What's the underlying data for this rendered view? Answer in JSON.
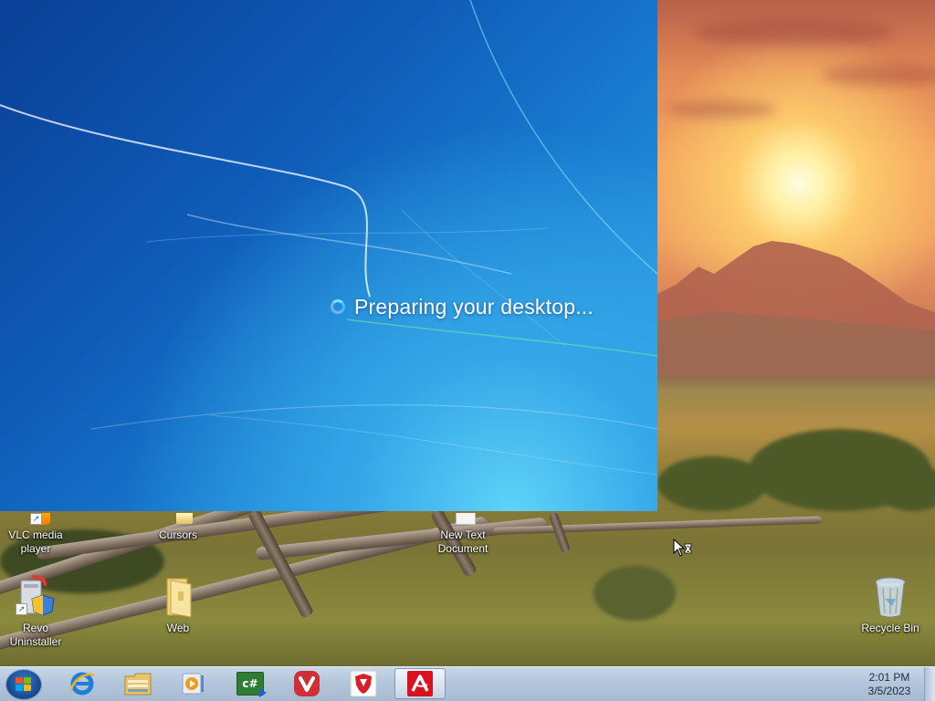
{
  "welcome": {
    "message": "Preparing your desktop..."
  },
  "desktop_icons": [
    {
      "label": "VLC media player",
      "icon": "vlc-icon",
      "shortcut": true
    },
    {
      "label": "Cursors",
      "icon": "folder-icon",
      "shortcut": false
    },
    {
      "label": "New Text Document",
      "icon": "text-document-icon",
      "shortcut": false
    },
    {
      "label": "Revo Uninstaller",
      "icon": "revo-uninstaller-icon",
      "shortcut": true
    },
    {
      "label": "Web",
      "icon": "folder-icon",
      "shortcut": false
    },
    {
      "label": "Recycle Bin",
      "icon": "recycle-bin-icon",
      "shortcut": false
    }
  ],
  "taskbar": {
    "start_icon": "windows-start-icon",
    "pinned": [
      {
        "name": "Internet Explorer",
        "icon": "internet-explorer-icon"
      },
      {
        "name": "Windows Explorer",
        "icon": "file-explorer-icon"
      },
      {
        "name": "Media Player",
        "icon": "media-player-icon"
      },
      {
        "name": "C# Editor",
        "icon": "csharp-editor-icon",
        "text": "c#"
      },
      {
        "name": "Vivaldi",
        "icon": "vivaldi-icon"
      },
      {
        "name": "Shield Antivirus",
        "icon": "shield-icon"
      },
      {
        "name": "Avira",
        "icon": "avira-icon",
        "active": true
      }
    ],
    "clock": {
      "time": "2:01 PM",
      "date": "3/5/2023"
    }
  },
  "colors": {
    "welcome_blue": "#0f5db8",
    "taskbar": "#b4c6dc",
    "vivaldi_red": "#d12f36",
    "avira_red": "#d8121f"
  }
}
